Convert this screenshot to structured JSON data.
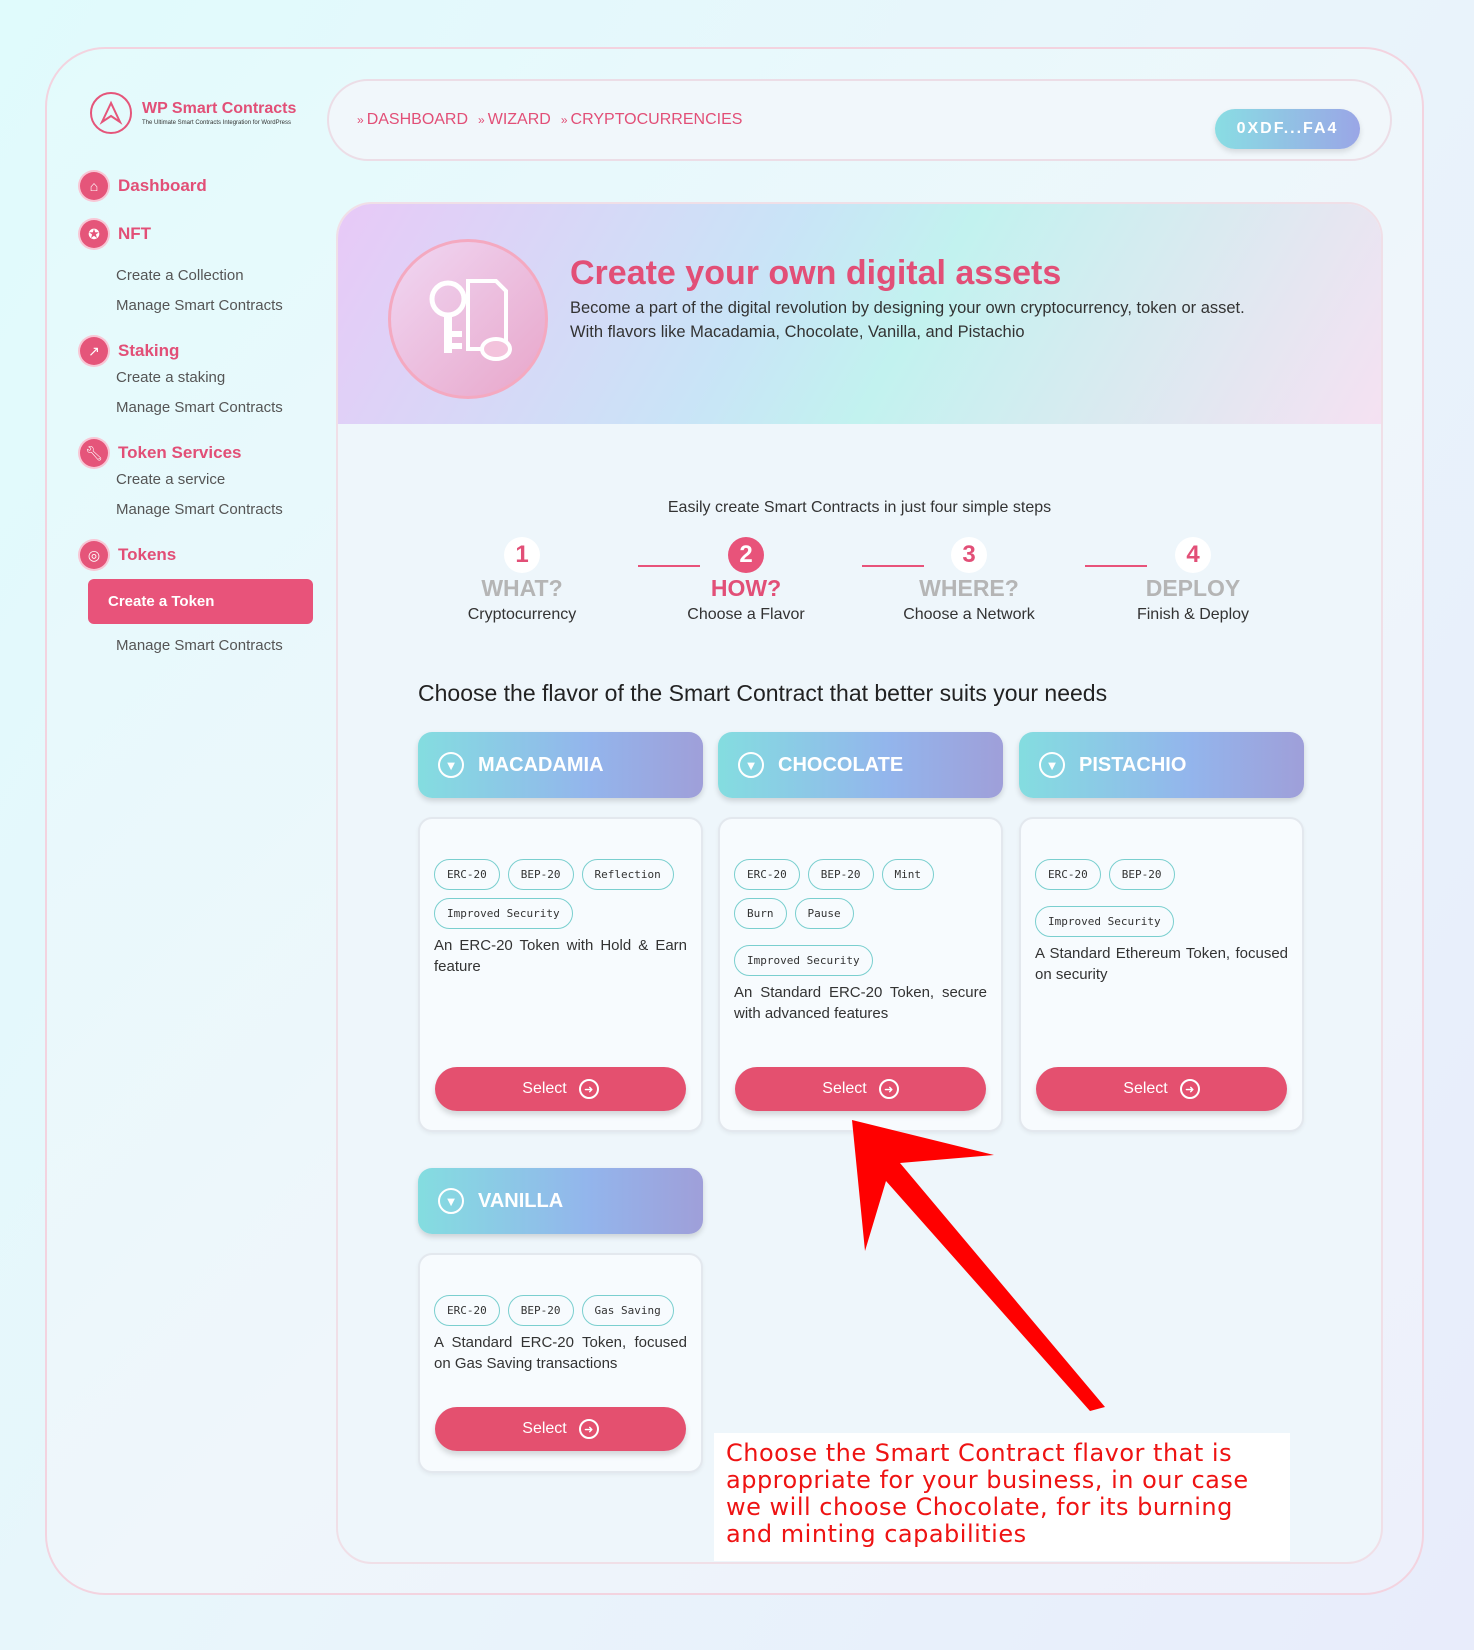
{
  "brand": {
    "title": "WP Smart Contracts",
    "subtitle": "The Ultimate Smart Contracts Integration for WordPress"
  },
  "sidebar": {
    "sections": [
      {
        "label": "Dashboard",
        "icon": "home-icon",
        "items": []
      },
      {
        "label": "NFT",
        "icon": "award-icon",
        "items": [
          "Create a Collection",
          "Manage Smart Contracts"
        ]
      },
      {
        "label": "Staking",
        "icon": "chart-icon",
        "items": [
          "Create a staking",
          "Manage Smart Contracts"
        ]
      },
      {
        "label": "Token Services",
        "icon": "wrench-icon",
        "items": [
          "Create a service",
          "Manage Smart Contracts"
        ]
      },
      {
        "label": "Tokens",
        "icon": "coin-icon",
        "items": [
          "Create a Token",
          "Manage Smart Contracts"
        ]
      }
    ],
    "active_item": "Create a Token"
  },
  "breadcrumbs": [
    "DASHBOARD",
    "WIZARD",
    "CRYPTOCURRENCIES"
  ],
  "wallet": "0XDF...FA4",
  "hero": {
    "title": "Create your own digital assets",
    "desc1": "Become a part of the digital revolution by designing your own cryptocurrency, token or asset.",
    "desc2": "With flavors like Macadamia, Chocolate, Vanilla, and Pistachio"
  },
  "steps_intro": "Easily create Smart Contracts in just four simple steps",
  "steps": [
    {
      "num": "1",
      "title": "WHAT?",
      "sub": "Cryptocurrency"
    },
    {
      "num": "2",
      "title": "HOW?",
      "sub": "Choose a Flavor",
      "active": true
    },
    {
      "num": "3",
      "title": "WHERE?",
      "sub": "Choose a Network"
    },
    {
      "num": "4",
      "title": "DEPLOY",
      "sub": "Finish & Deploy"
    }
  ],
  "choose_title": "Choose the flavor of the Smart Contract that better suits your needs",
  "flavors": [
    {
      "name": "MACADAMIA",
      "tags": [
        "ERC-20",
        "BEP-20",
        "Reflection",
        "Improved Security"
      ],
      "desc": "An ERC-20 Token with Hold & Earn feature",
      "button": "Select"
    },
    {
      "name": "CHOCOLATE",
      "tags": [
        "ERC-20",
        "BEP-20",
        "Mint",
        "Burn",
        "Pause",
        "Improved Security"
      ],
      "desc": "An Standard ERC-20 Token, secure with advanced features",
      "button": "Select"
    },
    {
      "name": "PISTACHIO",
      "tags": [
        "ERC-20",
        "BEP-20",
        "Improved Security"
      ],
      "desc": "A Standard Ethereum Token, focused on security",
      "button": "Select"
    },
    {
      "name": "VANILLA",
      "tags": [
        "ERC-20",
        "BEP-20",
        "Gas Saving"
      ],
      "desc": "A Standard ERC-20 Token, focused on Gas Saving transactions",
      "button": "Select"
    }
  ],
  "annotation": "Choose the Smart Contract flavor that is appropriate for your business, in our case we will choose Chocolate, for its burning and minting capabilities",
  "colors": {
    "accent": "#e8537a",
    "annotation": "#ee1313",
    "gradient_start": "#84dde0",
    "gradient_end": "#9f9fd9"
  }
}
